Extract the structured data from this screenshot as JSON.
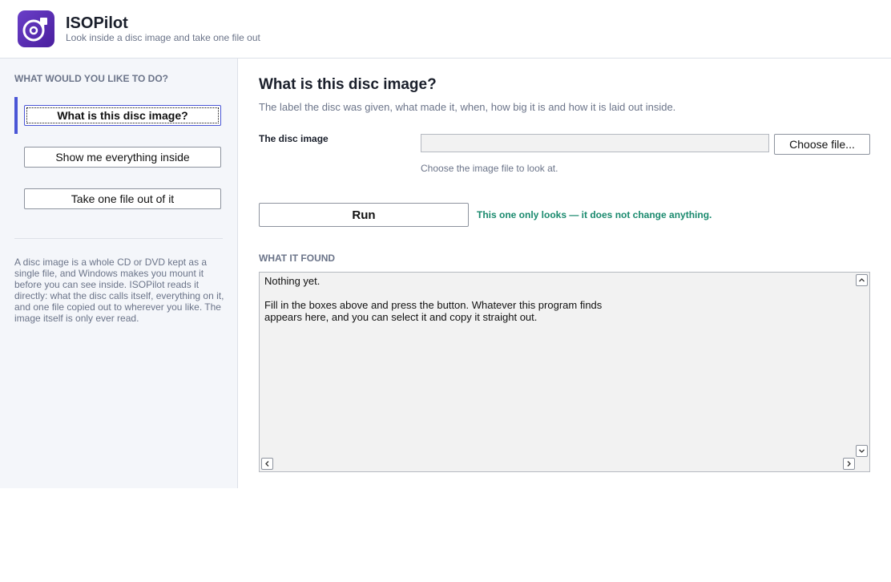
{
  "app": {
    "title": "ISOPilot",
    "subtitle": "Look inside a disc image and take one file out",
    "logo_icon": "disc-icon",
    "accent_color": "#5b34b8"
  },
  "sidebar": {
    "heading": "WHAT WOULD YOU LIKE TO DO?",
    "items": [
      {
        "label": "What is this disc image?",
        "active": true
      },
      {
        "label": "Show me everything inside",
        "active": false
      },
      {
        "label": "Take one file out of it",
        "active": false
      }
    ],
    "note": "A disc image is a whole CD or DVD kept as a single file, and Windows makes you mount it before you can see inside. ISOPilot reads it directly: what the disc calls itself, everything on it, and one file copied out to wherever you like. The image itself is only ever read."
  },
  "main": {
    "title": "What is this disc image?",
    "description": "The label the disc was given, what made it, when, how big it is and how it is laid out inside.",
    "field": {
      "label": "The disc image",
      "value": "",
      "button_label": "Choose file...",
      "hint": "Choose the image file to look at."
    },
    "run_label": "Run",
    "run_note": "This one only looks — it does not change anything.",
    "run_note_color": "#1a8a6e",
    "results": {
      "heading": "WHAT IT FOUND",
      "text": "Nothing yet.\n\nFill in the boxes above and press the button. Whatever this program finds\nappears here, and you can select it and copy it straight out."
    }
  }
}
